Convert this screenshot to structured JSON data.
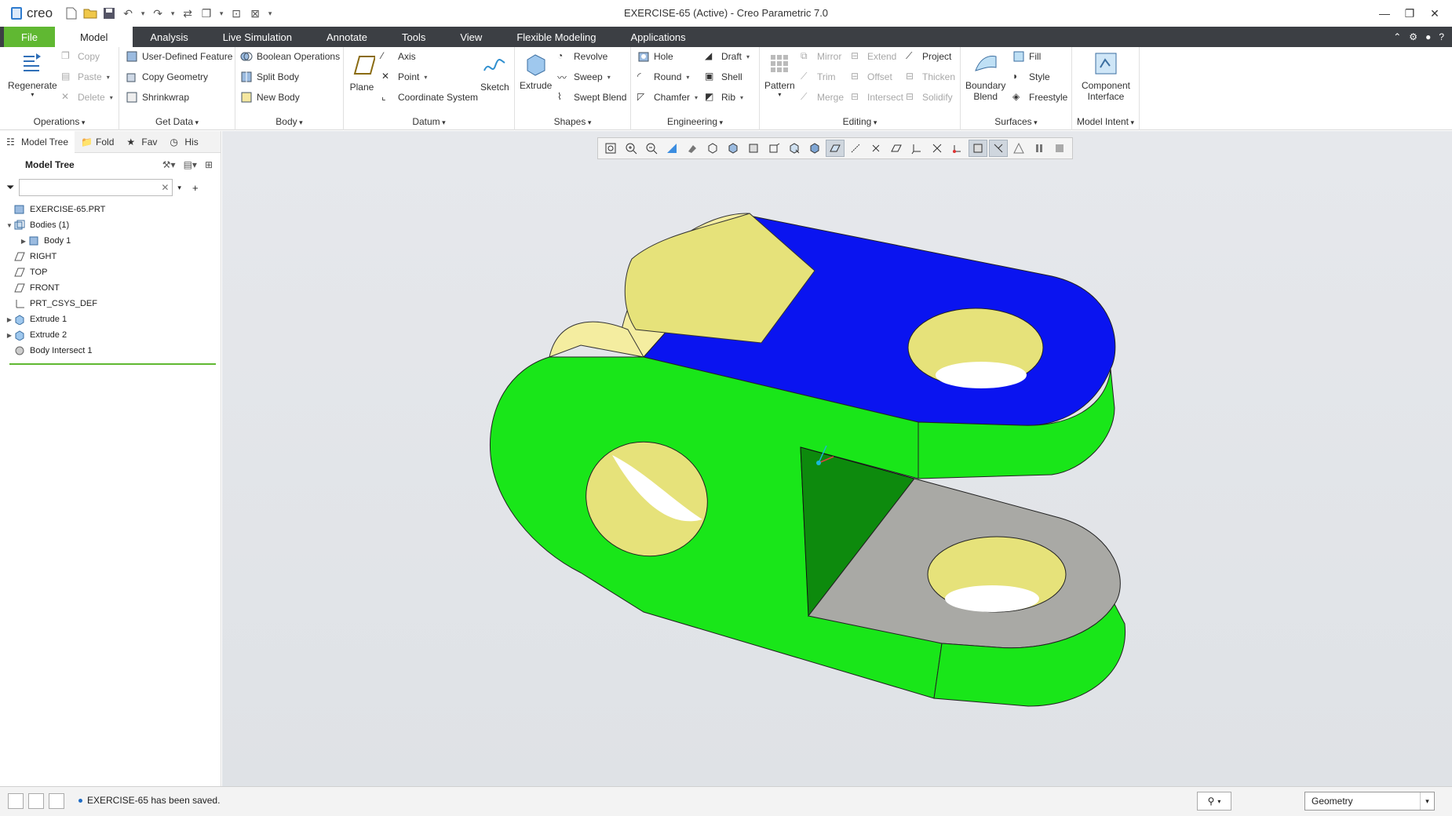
{
  "app": {
    "logo": "creo",
    "window_title": "EXERCISE-65 (Active) - Creo Parametric 7.0"
  },
  "tabs": [
    "File",
    "Model",
    "Analysis",
    "Live Simulation",
    "Annotate",
    "Tools",
    "View",
    "Flexible Modeling",
    "Applications"
  ],
  "ribbon": {
    "operations": {
      "label": "Operations",
      "regenerate": "Regenerate",
      "copy": "Copy",
      "paste": "Paste",
      "delete": "Delete"
    },
    "getdata": {
      "label": "Get Data",
      "udf": "User-Defined Feature",
      "copy_geometry": "Copy Geometry",
      "shrinkwrap": "Shrinkwrap"
    },
    "body": {
      "label": "Body",
      "boolean": "Boolean Operations",
      "split": "Split Body",
      "new": "New Body"
    },
    "datum": {
      "label": "Datum",
      "plane": "Plane",
      "axis": "Axis",
      "point": "Point",
      "csys": "Coordinate System",
      "sketch": "Sketch"
    },
    "shapes": {
      "label": "Shapes",
      "extrude": "Extrude",
      "revolve": "Revolve",
      "sweep": "Sweep",
      "swept_blend": "Swept Blend"
    },
    "engineering": {
      "label": "Engineering",
      "hole": "Hole",
      "round": "Round",
      "chamfer": "Chamfer",
      "draft": "Draft",
      "shell": "Shell",
      "rib": "Rib"
    },
    "editing": {
      "label": "Editing",
      "pattern": "Pattern",
      "mirror": "Mirror",
      "trim": "Trim",
      "merge": "Merge",
      "extend": "Extend",
      "offset": "Offset",
      "intersect": "Intersect",
      "project": "Project",
      "thicken": "Thicken",
      "solidify": "Solidify"
    },
    "surfaces": {
      "label": "Surfaces",
      "boundary_blend_1": "Boundary",
      "boundary_blend_2": "Blend",
      "fill": "Fill",
      "style": "Style",
      "freestyle": "Freestyle"
    },
    "model_intent": {
      "label": "Model Intent",
      "component_interface_1": "Component",
      "component_interface_2": "Interface"
    }
  },
  "left_panel": {
    "tabs": [
      "Model Tree",
      "Fold",
      "Fav",
      "His"
    ],
    "header": "Model Tree",
    "search_value": "",
    "tree": [
      {
        "label": "EXERCISE-65.PRT",
        "level": 0,
        "expander": "",
        "icon": "part-icon"
      },
      {
        "label": "Bodies (1)",
        "level": 0,
        "expander": "▼",
        "icon": "bodies-icon"
      },
      {
        "label": "Body 1",
        "level": 1,
        "expander": "▶",
        "icon": "body-icon"
      },
      {
        "label": "RIGHT",
        "level": 0,
        "expander": "",
        "icon": "datum-plane-icon"
      },
      {
        "label": "TOP",
        "level": 0,
        "expander": "",
        "icon": "datum-plane-icon"
      },
      {
        "label": "FRONT",
        "level": 0,
        "expander": "",
        "icon": "datum-plane-icon"
      },
      {
        "label": "PRT_CSYS_DEF",
        "level": 0,
        "expander": "",
        "icon": "csys-icon"
      },
      {
        "label": "Extrude 1",
        "level": 0,
        "expander": "▶",
        "icon": "extrude-icon"
      },
      {
        "label": "Extrude 2",
        "level": 0,
        "expander": "▶",
        "icon": "extrude-icon"
      },
      {
        "label": "Body Intersect 1",
        "level": 0,
        "expander": "",
        "icon": "body-intersect-icon"
      }
    ]
  },
  "status": {
    "message": "EXERCISE-65 has been saved.",
    "filter_value": "Geometry"
  },
  "colors": {
    "file_tab": "#60b832",
    "tab_bar": "#3c3f44",
    "face_green": "#19e619",
    "face_blue": "#0a14f0",
    "face_yellow": "#e6e27a",
    "face_gray": "#a9a9a5"
  }
}
